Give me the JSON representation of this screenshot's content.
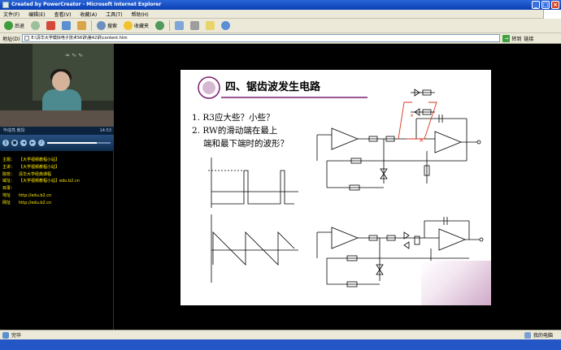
{
  "window": {
    "title": "Created by PowerCreator - Microsoft Internet Explorer",
    "controls": [
      "_",
      "□",
      "×"
    ]
  },
  "menu": [
    "文件(F)",
    "编辑(E)",
    "查看(V)",
    "收藏(A)",
    "工具(T)",
    "帮助(H)"
  ],
  "toolbar": {
    "back": "后退",
    "search": "搜索",
    "favorites": "收藏夹"
  },
  "address": {
    "label": "地址(D)",
    "value": "E:\\清华大学模拟电子技术56讲\\第42讲\\content.htm",
    "go": "转到",
    "links": "链接"
  },
  "player": {
    "left_status": "毕成亮    教授",
    "time": "14:53",
    "progress": 0.78
  },
  "course_info": [
    {
      "k": "主题：",
      "v": "【大学视频教程小站】"
    },
    {
      "k": "主讲：",
      "v": "【大学视频教程小站】"
    },
    {
      "k": "院校：",
      "v": "清华大学经典课程"
    },
    {
      "k": "域址：",
      "v": "【大学视频教程小站】edu.b2.cn"
    },
    {
      "k": "目录：",
      "v": ""
    },
    {
      "k": "  地址",
      "v": "http://edu.b2.cn"
    },
    {
      "k": "  网址",
      "v": "http://edu.b2.cn"
    }
  ],
  "slide": {
    "title": "四、锯齿波发生电路",
    "q1": "1. R3应大些？小些？",
    "q2": "2. RW的滑动端在最上",
    "q3": "端和最下端时的波形？",
    "labels": {
      "d1": "D1",
      "d2": "D2",
      "r4": "R4",
      "r5": "R5",
      "r1": "R1",
      "r2": "R2",
      "r3": "R3",
      "a1": "A1",
      "a2": "A2",
      "c": "C",
      "uo": "uO",
      "uo1": "uO1",
      "ut": "±UT",
      "dz": "DZ",
      "r0": "R0",
      "rw": "Rw"
    },
    "waveform_labels": {
      "uo1": "uO1",
      "uz_pos": "+UZ",
      "uz_neg": "-UZ",
      "t1": "T1",
      "t2": "T2",
      "t": "t",
      "uo": "uO",
      "ut_pos": "+UT",
      "ut_neg": "-UT"
    }
  },
  "status": {
    "left": "完毕",
    "right": "我的电脑"
  },
  "colors": {
    "title_blue": "#0a3fb4",
    "chrome": "#ece9d8",
    "info_yellow": "#ffea00",
    "red_wire": "#d8331c"
  }
}
